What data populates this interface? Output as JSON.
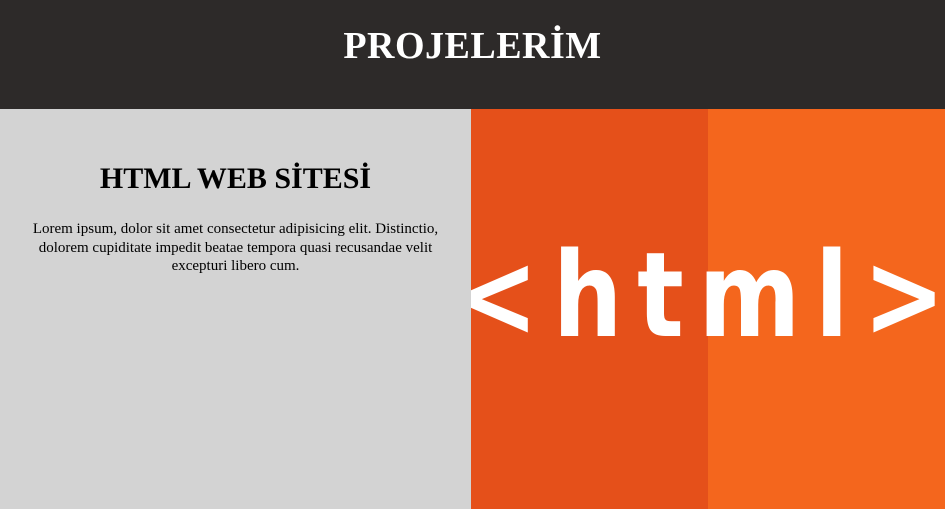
{
  "header": {
    "title": "PROJELERİM"
  },
  "project": {
    "title": "HTML WEB SİTESİ",
    "description": "Lorem ipsum, dolor sit amet consectetur adipisicing elit. Distinctio, dolorem cupiditate impedit beatae tempora quasi recusandae velit excepturi libero cum.",
    "image": {
      "logo_text": "<html>",
      "left_color": "#e5501a",
      "right_color": "#f4661d",
      "text_color": "#ffffff"
    }
  },
  "colors": {
    "header_bg": "#2d2a29",
    "info_bg": "#d3d3d3"
  }
}
